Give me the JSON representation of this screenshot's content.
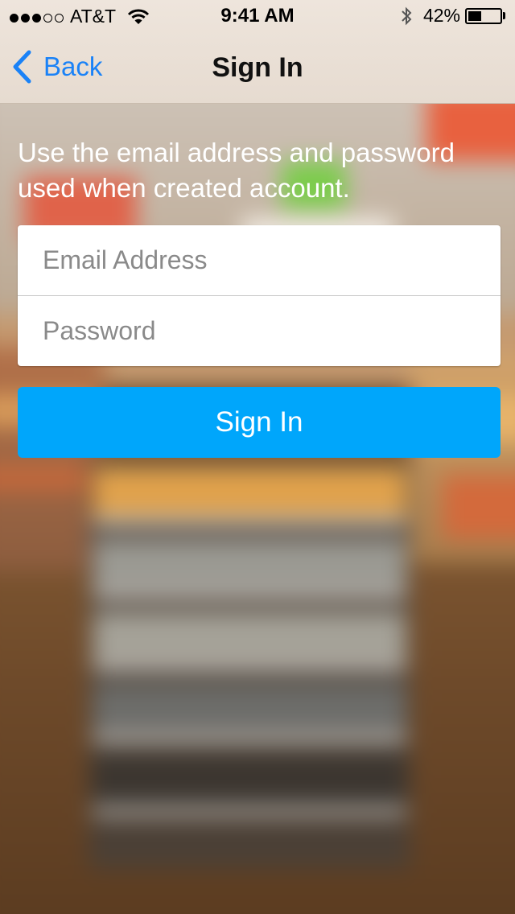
{
  "status_bar": {
    "carrier": "AT&T",
    "signal_bars_filled": 3,
    "signal_bars_total": 5,
    "time": "9:41 AM",
    "battery_percent_text": "42%",
    "battery_level": 0.42
  },
  "nav": {
    "back_label": "Back",
    "title": "Sign In"
  },
  "form": {
    "instructions": "Use the email address and password used when created account.",
    "email": {
      "value": "",
      "placeholder": "Email Address"
    },
    "password": {
      "value": "",
      "placeholder": "Password"
    },
    "submit_label": "Sign In"
  },
  "colors": {
    "accent": "#1a82f7",
    "button": "#00a6fb",
    "nav_background": "#e9dfd5"
  },
  "icons": [
    "wifi-icon",
    "bluetooth-icon",
    "battery-icon",
    "chevron-left-icon"
  ]
}
